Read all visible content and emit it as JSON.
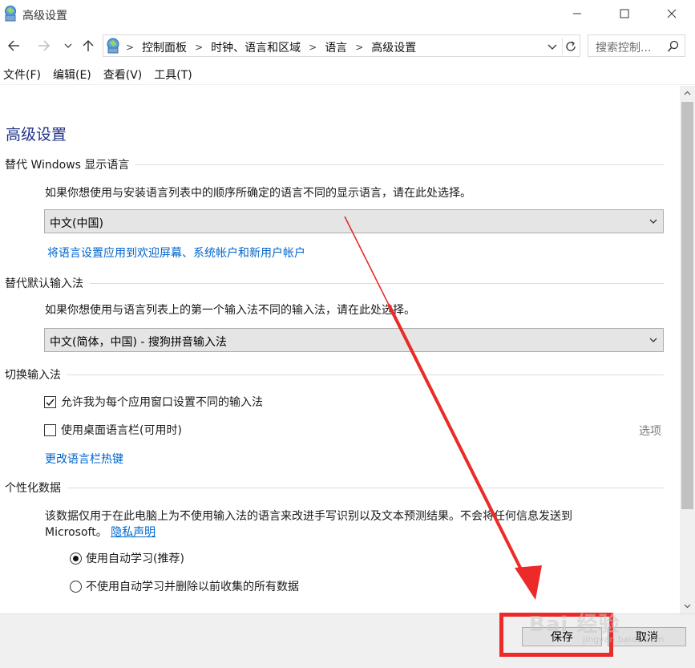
{
  "window": {
    "title": "高级设置"
  },
  "nav": {
    "breadcrumbs": [
      "控制面板",
      "时钟、语言和区域",
      "语言",
      "高级设置"
    ],
    "search_placeholder": "搜索控制..."
  },
  "menu": [
    "文件(F)",
    "编辑(E)",
    "查看(V)",
    "工具(T)"
  ],
  "page": {
    "title": "高级设置",
    "display_language": {
      "heading": "替代 Windows 显示语言",
      "description": "如果你想使用与安装语言列表中的顺序所确定的语言不同的显示语言，请在此处选择。",
      "selected": "中文(中国)",
      "link": "将语言设置应用到欢迎屏幕、系统帐户和新用户帐户"
    },
    "default_input": {
      "heading": "替代默认输入法",
      "description": "如果你想使用与语言列表上的第一个输入法不同的输入法，请在此处选择。",
      "selected": "中文(简体，中国) - 搜狗拼音输入法"
    },
    "switch_input": {
      "heading": "切换输入法",
      "checkbox1": {
        "label": "允许我为每个应用窗口设置不同的输入法",
        "checked": true
      },
      "checkbox2": {
        "label": "使用桌面语言栏(可用时)",
        "checked": false
      },
      "options_link": "选项",
      "hotkey_link": "更改语言栏热键"
    },
    "personalization": {
      "heading": "个性化数据",
      "description_line1": "该数据仅用于在此电脑上为不使用输入法的语言来改进手写识别以及文本预测结果。不会将任何信息发送到",
      "description_line2": "Microsoft。",
      "privacy_link": "隐私声明",
      "radio1": {
        "label": "使用自动学习(推荐)",
        "selected": true
      },
      "radio2": {
        "label": "不使用自动学习并删除以前收集的所有数据",
        "selected": false
      }
    }
  },
  "footer": {
    "save_label": "保存",
    "cancel_label": "取消"
  },
  "watermark": {
    "text": "Bai 经验",
    "sub": "jingyan.baidu.com"
  },
  "colors": {
    "link": "#0066cc",
    "title": "#1e3287",
    "annotation": "#ec2a2a"
  }
}
